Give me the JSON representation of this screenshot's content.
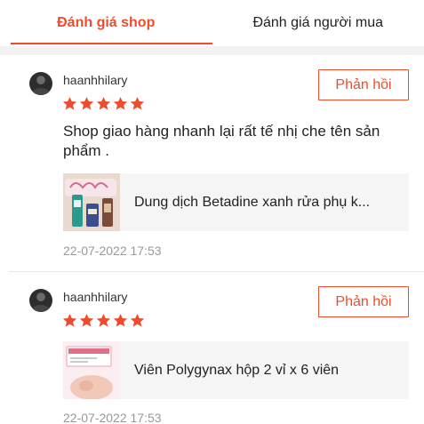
{
  "tabs": [
    {
      "label": "Đánh giá shop",
      "active": true
    },
    {
      "label": "Đánh giá người mua",
      "active": false
    }
  ],
  "accent_color": "#ee4d2d",
  "star_color": "#ee4d2d",
  "reviews": [
    {
      "username": "haanhhilary",
      "rating": 5,
      "reply_label": "Phản hồi",
      "comment": "Shop giao hàng nhanh lại rất tế nhị che tên sản phẩm .",
      "product_name": "Dung dịch Betadine xanh rửa phụ k...",
      "product_thumb_text": "Mun Shop",
      "date": "22-07-2022 17:53"
    },
    {
      "username": "haanhhilary",
      "rating": 5,
      "reply_label": "Phản hồi",
      "comment": "",
      "product_name": "Viên Polygynax hộp 2 vỉ x 6 viên",
      "product_thumb_text": "POLYGYNAX",
      "date": "22-07-2022 17:53"
    }
  ]
}
